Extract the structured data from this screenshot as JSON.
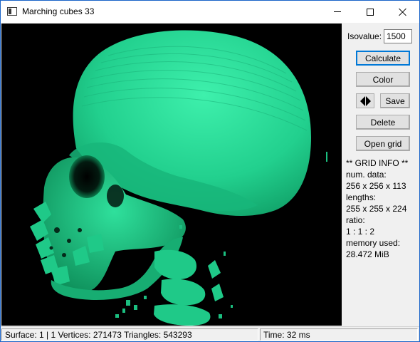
{
  "window": {
    "title": "Marching cubes 33"
  },
  "viewport": {
    "background": "#000000",
    "surface_color": "#22d08e",
    "content": "3d-skull-isosurface"
  },
  "panel": {
    "isovalue_label": "Isovalue:",
    "isovalue_value": "1500",
    "calculate_label": "Calculate",
    "color_label": "Color",
    "save_label": "Save",
    "delete_label": "Delete",
    "open_grid_label": "Open grid",
    "info": {
      "header": "** GRID  INFO **",
      "num_data_label": "num. data:",
      "num_data_value": "256 x 256 x 113",
      "lengths_label": "lengths:",
      "lengths_value": "255 x 255 x 224",
      "ratio_label": "ratio:",
      "ratio_value": "1 : 1 : 2",
      "memory_label": "memory used:",
      "memory_value": "28.472 MiB"
    }
  },
  "statusbar": {
    "main": "Surface: 1 | 1   Vertices: 271473   Triangles: 543293",
    "time": "Time: 32 ms"
  }
}
